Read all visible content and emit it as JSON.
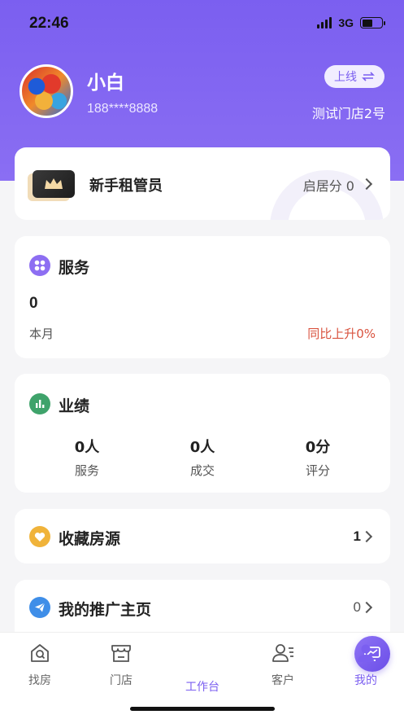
{
  "status_bar": {
    "time": "22:46",
    "network": "3G"
  },
  "profile": {
    "name": "小白",
    "phone": "188****8888",
    "online_label": "上线",
    "store_name": "测试门店2号"
  },
  "rank": {
    "title": "新手租管员",
    "score_label": "启居分 0"
  },
  "service": {
    "title": "服务",
    "value": "0",
    "period_label": "本月",
    "yoy_label": "同比上升0%"
  },
  "performance": {
    "title": "业绩",
    "items": [
      {
        "value": "0人",
        "label": "服务"
      },
      {
        "value": "0人",
        "label": "成交"
      },
      {
        "value": "0分",
        "label": "评分"
      }
    ]
  },
  "favorites": {
    "title": "收藏房源",
    "count": "1"
  },
  "promo": {
    "title": "我的推广主页",
    "count": "0"
  },
  "tabs": [
    {
      "label": "找房",
      "icon": "search-house-icon"
    },
    {
      "label": "门店",
      "icon": "store-icon"
    },
    {
      "label": "工作台",
      "icon": "workbench-icon"
    },
    {
      "label": "客户",
      "icon": "customers-icon"
    },
    {
      "label": "我的",
      "icon": "profile-icon"
    }
  ],
  "colors": {
    "accent": "#7b5ff0",
    "red": "#d9533f",
    "green": "#3fa36b",
    "amber": "#f0b33a",
    "blue": "#3f8ee8"
  }
}
